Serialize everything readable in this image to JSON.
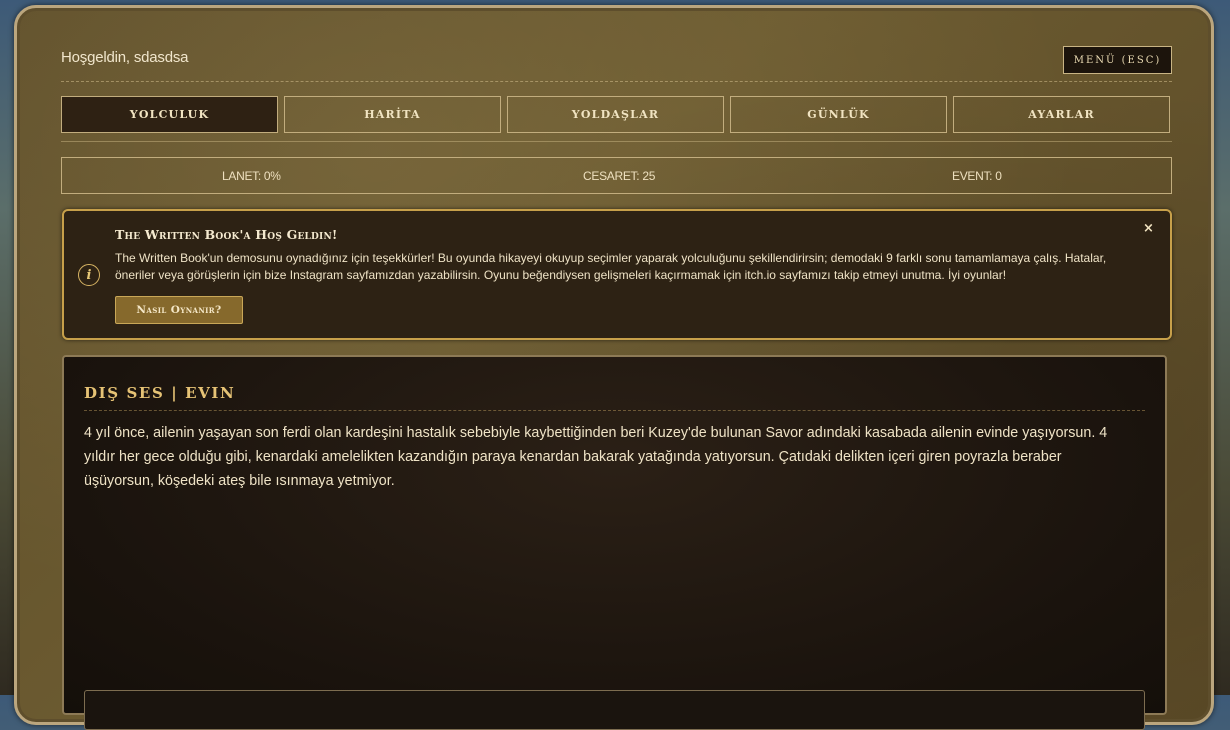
{
  "header": {
    "welcome": "Hoşgeldin, sdasdsa",
    "menu_label": "MENÜ (ESC)"
  },
  "tabs": [
    {
      "label": "YOLCULUK",
      "active": true
    },
    {
      "label": "HARİTA",
      "active": false
    },
    {
      "label": "YOLDAŞLAR",
      "active": false
    },
    {
      "label": "GÜNLÜK",
      "active": false
    },
    {
      "label": "AYARLAR",
      "active": false
    }
  ],
  "stats": {
    "lanet": "LANET: 0%",
    "cesaret": "CESARET: 25",
    "event": "EVENT: 0"
  },
  "notice": {
    "icon": "info-icon",
    "title": "The Written Book'a Hoş Geldin!",
    "body": "The Written Book'un demosunu oynadığınız için teşekkürler! Bu oyunda hikayeyi okuyup seçimler yaparak yolculuğunu şekillendirirsin; demodaki 9 farklı sonu tamamlamaya çalış. Hatalar, öneriler veya görüşlerin için bize Instagram sayfamızdan yazabilirsin. Oyunu beğendiysen gelişmeleri kaçırmamak için itch.io sayfamızı takip etmeyi unutma. İyi oyunlar!",
    "close": "×",
    "button": "Nasıl Oynanır?"
  },
  "story": {
    "title": "DIŞ SES | EVIN",
    "text": "4 yıl önce, ailenin yaşayan son ferdi olan kardeşini hastalık sebebiyle kaybettiğinden beri Kuzey'de bulunan Savor adındaki kasabada ailenin evinde yaşıyorsun. 4 yıldır her gece olduğu gibi, kenardaki amelelikten kazandığın paraya kenardan bakarak yatağında yatıyorsun. Çatıdaki delikten içeri giren poyrazla beraber üşüyorsun, köşedeki ateş bile ısınmaya yetmiyor."
  },
  "colors": {
    "accent": "#c7a04a",
    "panel_bg": "#2d2214",
    "frame": "#6b5a30",
    "title_gold": "#e6c375"
  }
}
